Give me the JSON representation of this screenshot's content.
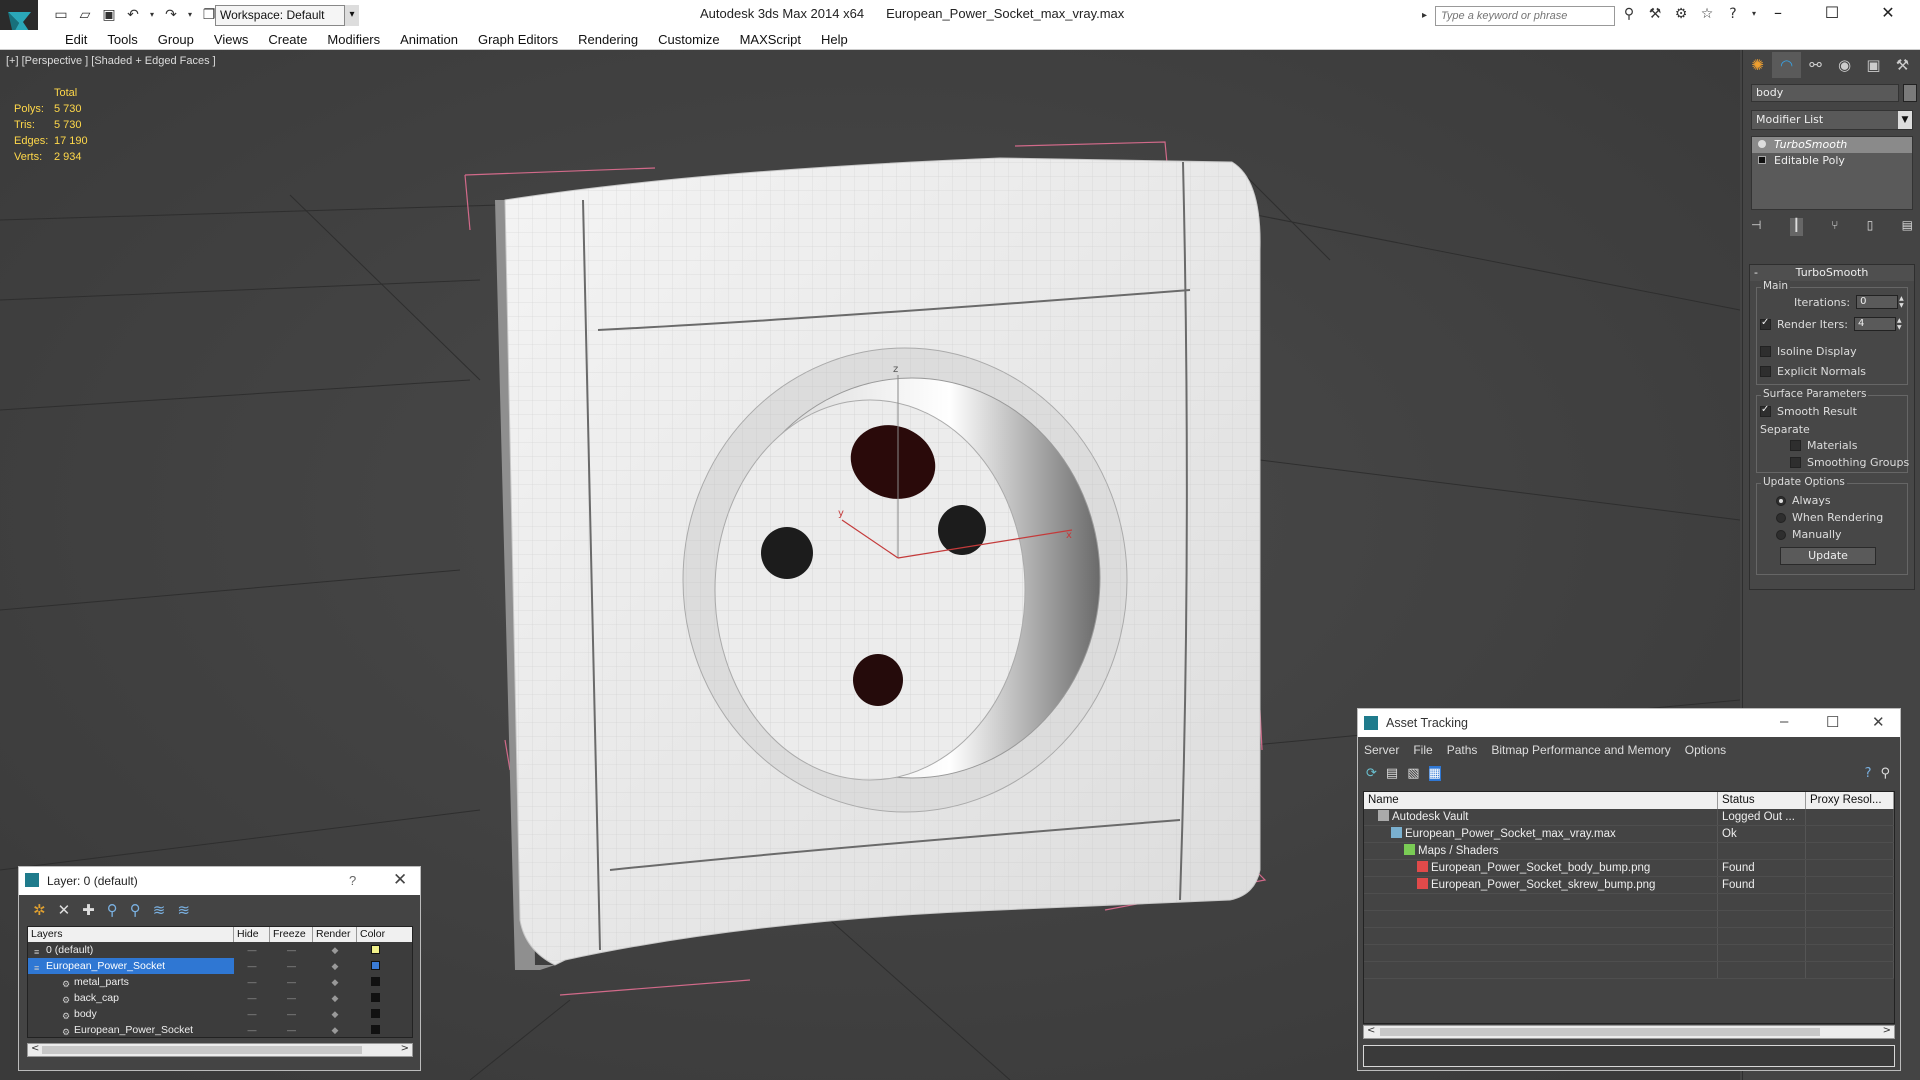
{
  "titlebar": {
    "app_name": "Autodesk 3ds Max  2014 x64",
    "file_name": "European_Power_Socket_max_vray.max",
    "workspace_value": "Workspace: Default",
    "search_placeholder": "Type a keyword or phrase"
  },
  "menu": [
    "Edit",
    "Tools",
    "Group",
    "Views",
    "Create",
    "Modifiers",
    "Animation",
    "Graph Editors",
    "Rendering",
    "Customize",
    "MAXScript",
    "Help"
  ],
  "viewport": {
    "label": "[+] [Perspective ] [Shaded + Edged Faces ]",
    "stats": {
      "total_label": "Total",
      "rows": [
        {
          "k": "Polys:",
          "v": "5 730"
        },
        {
          "k": "Tris:",
          "v": "5 730"
        },
        {
          "k": "Edges:",
          "v": "17 190"
        },
        {
          "k": "Verts:",
          "v": "2 934"
        }
      ]
    },
    "gizmo": {
      "z": "z",
      "y": "y",
      "x": "x"
    }
  },
  "command_panel": {
    "object_name": "body",
    "modifier_list": "Modifier List",
    "stack": [
      {
        "label": "TurboSmooth",
        "selected": true
      },
      {
        "label": "Editable Poly",
        "selected": false
      }
    ],
    "rollout_title": "TurboSmooth",
    "main_label": "Main",
    "iterations_label": "Iterations:",
    "iterations_value": "0",
    "render_iters_label": "Render Iters:",
    "render_iters_value": "4",
    "isoline_label": "Isoline Display",
    "explicit_normals_label": "Explicit Normals",
    "surface_params_label": "Surface Parameters",
    "smooth_result_label": "Smooth Result",
    "separate_label": "Separate",
    "materials_label": "Materials",
    "smoothing_groups_label": "Smoothing Groups",
    "update_options_label": "Update Options",
    "always_label": "Always",
    "when_rendering_label": "When Rendering",
    "manually_label": "Manually",
    "update_button": "Update"
  },
  "layer_window": {
    "title": "Layer: 0 (default)",
    "help": "?",
    "columns": [
      "Layers",
      "Hide",
      "Freeze",
      "Render",
      "Color"
    ],
    "rows": [
      {
        "name": "0 (default)",
        "child": false,
        "selected": false,
        "color": "#f0f08a"
      },
      {
        "name": "European_Power_Socket",
        "child": false,
        "selected": true,
        "color": "#3a7bd6"
      },
      {
        "name": "metal_parts",
        "child": true,
        "selected": false,
        "color": "#111111"
      },
      {
        "name": "back_cap",
        "child": true,
        "selected": false,
        "color": "#111111"
      },
      {
        "name": "body",
        "child": true,
        "selected": false,
        "color": "#111111"
      },
      {
        "name": "European_Power_Socket",
        "child": true,
        "selected": false,
        "color": "#111111"
      }
    ]
  },
  "asset_window": {
    "title": "Asset Tracking",
    "menu": [
      "Server",
      "File",
      "Paths",
      "Bitmap Performance and Memory",
      "Options"
    ],
    "columns": [
      "Name",
      "Status",
      "Proxy Resol..."
    ],
    "rows": [
      {
        "name": "Autodesk Vault",
        "indent": 0,
        "status": "Logged Out ...",
        "icon": "vault-icon"
      },
      {
        "name": "European_Power_Socket_max_vray.max",
        "indent": 1,
        "status": "Ok",
        "icon": "max-file-icon"
      },
      {
        "name": "Maps / Shaders",
        "indent": 2,
        "status": "",
        "icon": "maps-icon"
      },
      {
        "name": "European_Power_Socket_body_bump.png",
        "indent": 3,
        "status": "Found",
        "icon": "png-icon"
      },
      {
        "name": "European_Power_Socket_skrew_bump.png",
        "indent": 3,
        "status": "Found",
        "icon": "png-icon"
      }
    ]
  }
}
